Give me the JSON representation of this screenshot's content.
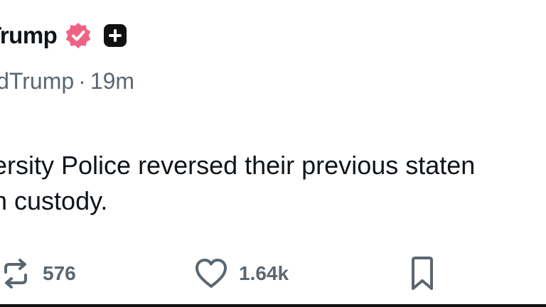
{
  "post": {
    "display_name": "Trump",
    "handle": "ldTrump",
    "separator": "·",
    "time": "19m",
    "body": "ersity Police reversed their previous staten\nn custody."
  },
  "actions": {
    "repost_count": "576",
    "like_count": "1.64k"
  },
  "colors": {
    "verified": "#f06283",
    "plus_badge": "#111111",
    "muted_text": "#5b6670"
  },
  "icons": {
    "verified": "verified-badge-icon",
    "plus": "plus-square-icon",
    "repost": "repost-icon",
    "like": "heart-icon",
    "bookmark": "bookmark-icon"
  }
}
